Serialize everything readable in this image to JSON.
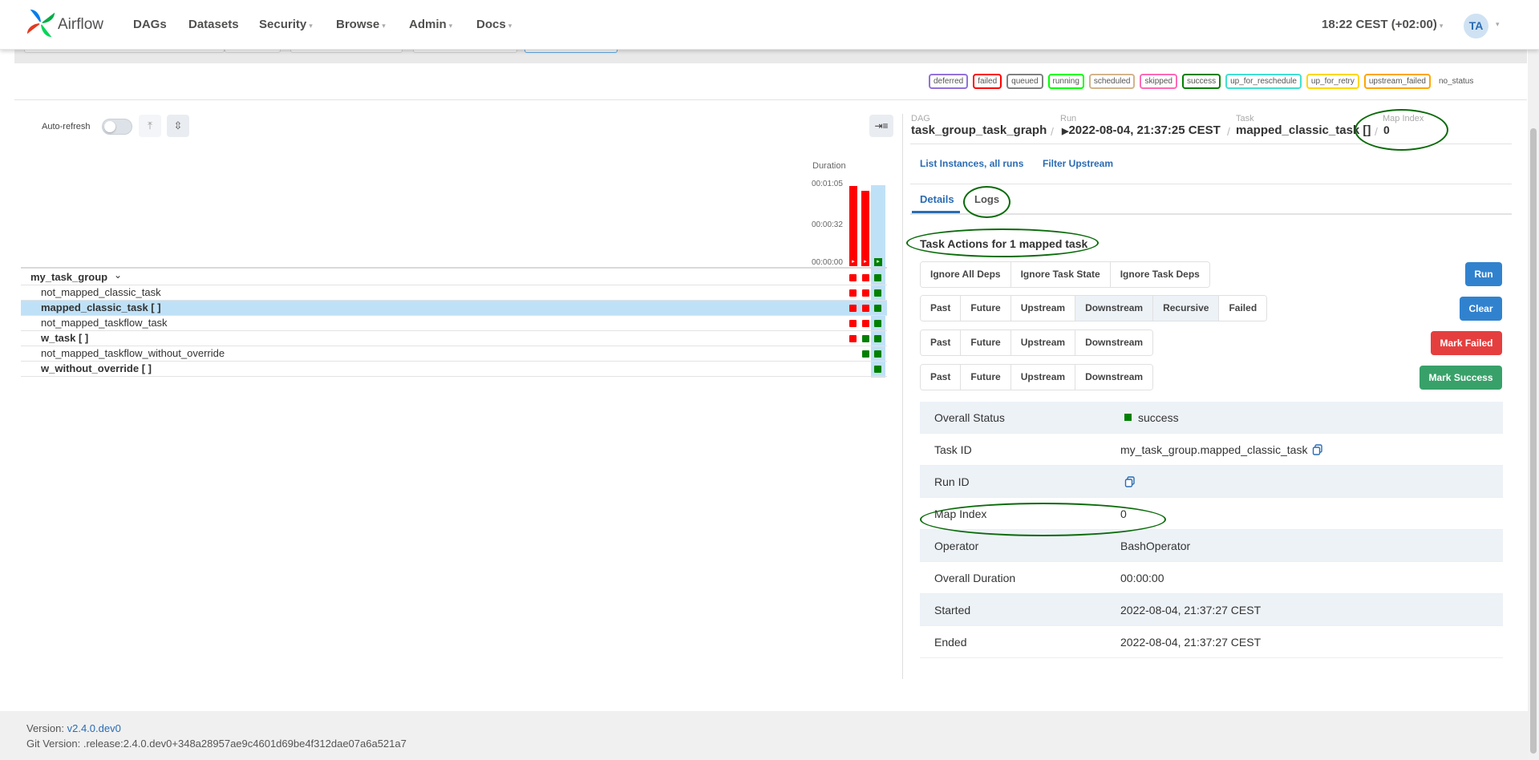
{
  "navbar": {
    "brand": "Airflow",
    "items": [
      {
        "label": "DAGs",
        "dropdown": false
      },
      {
        "label": "Datasets",
        "dropdown": false
      },
      {
        "label": "Security",
        "dropdown": true
      },
      {
        "label": "Browse",
        "dropdown": true
      },
      {
        "label": "Admin",
        "dropdown": true
      },
      {
        "label": "Docs",
        "dropdown": true
      }
    ],
    "clock": "18:22 CEST (+02:00)",
    "avatar": "TA"
  },
  "legend": {
    "states": [
      {
        "label": "deferred",
        "color": "#9370db"
      },
      {
        "label": "failed",
        "color": "#ff0000"
      },
      {
        "label": "queued",
        "color": "#808080"
      },
      {
        "label": "running",
        "color": "#00ff00"
      },
      {
        "label": "scheduled",
        "color": "#d2b48c"
      },
      {
        "label": "skipped",
        "color": "#ff69b4"
      },
      {
        "label": "success",
        "color": "#008000"
      },
      {
        "label": "up_for_reschedule",
        "color": "#40e0d0"
      },
      {
        "label": "up_for_retry",
        "color": "#ffd700"
      },
      {
        "label": "upstream_failed",
        "color": "#ffa500"
      }
    ],
    "no_status": "no_status"
  },
  "grid": {
    "auto_refresh_label": "Auto-refresh",
    "duration_label": "Duration",
    "duration_ticks": [
      "00:01:05",
      "00:00:32",
      "00:00:00"
    ],
    "runs": [
      {
        "duration_seconds": 65,
        "state": "failed"
      },
      {
        "duration_seconds": 61,
        "state": "failed"
      },
      {
        "duration_seconds": 0,
        "state": "success"
      }
    ],
    "tasks": [
      {
        "name": "my_task_group",
        "kind": "group",
        "selected": false,
        "states": [
          "failed",
          "failed",
          "success"
        ]
      },
      {
        "name": "not_mapped_classic_task",
        "kind": "task",
        "selected": false,
        "states": [
          "failed",
          "failed",
          "success"
        ]
      },
      {
        "name": "mapped_classic_task [ ]",
        "kind": "mapped",
        "selected": true,
        "states": [
          "failed",
          "failed",
          "success"
        ]
      },
      {
        "name": "not_mapped_taskflow_task",
        "kind": "task",
        "selected": false,
        "states": [
          "failed",
          "failed",
          "success"
        ]
      },
      {
        "name": "w_task [ ]",
        "kind": "mapped",
        "selected": false,
        "states": [
          "failed",
          "success",
          "success"
        ]
      },
      {
        "name": "not_mapped_taskflow_without_override",
        "kind": "task",
        "selected": false,
        "states": [
          null,
          "success",
          "success"
        ]
      },
      {
        "name": "w_without_override [ ]",
        "kind": "mapped",
        "selected": false,
        "states": [
          null,
          null,
          "success"
        ]
      }
    ]
  },
  "breadcrumb": {
    "dag_label": "DAG",
    "dag": "task_group_task_graph",
    "run_label": "Run",
    "run": "2022-08-04, 21:37:25 CEST",
    "task_label": "Task",
    "task": "mapped_classic_task []",
    "map_index_label": "Map Index",
    "map_index": "0"
  },
  "links": {
    "list_instances": "List Instances, all runs",
    "filter_upstream": "Filter Upstream"
  },
  "tabs": {
    "details": "Details",
    "logs": "Logs"
  },
  "actions": {
    "title": "Task Actions for 1 mapped task",
    "run_group": [
      "Ignore All Deps",
      "Ignore Task State",
      "Ignore Task Deps"
    ],
    "run_button": "Run",
    "clear_group": [
      {
        "label": "Past",
        "on": false
      },
      {
        "label": "Future",
        "on": false
      },
      {
        "label": "Upstream",
        "on": false
      },
      {
        "label": "Downstream",
        "on": true
      },
      {
        "label": "Recursive",
        "on": true
      },
      {
        "label": "Failed",
        "on": false
      }
    ],
    "clear_button": "Clear",
    "failed_group": [
      "Past",
      "Future",
      "Upstream",
      "Downstream"
    ],
    "mark_failed_button": "Mark Failed",
    "success_group": [
      "Past",
      "Future",
      "Upstream",
      "Downstream"
    ],
    "mark_success_button": "Mark Success",
    "colors": {
      "run": "#3182ce",
      "clear": "#3182ce",
      "mark_failed": "#e53e3e",
      "mark_success": "#38a169"
    }
  },
  "details": {
    "rows": [
      {
        "key": "Overall Status",
        "value": "success",
        "status_color": "#008000"
      },
      {
        "key": "Task ID",
        "value": "my_task_group.mapped_classic_task",
        "copy": true
      },
      {
        "key": "Run ID",
        "value": "",
        "copy": true
      },
      {
        "key": "Map Index",
        "value": "0"
      },
      {
        "key": "Operator",
        "value": "BashOperator"
      },
      {
        "key": "Overall Duration",
        "value": "00:00:00"
      },
      {
        "key": "Started",
        "value": "2022-08-04, 21:37:27 CEST"
      },
      {
        "key": "Ended",
        "value": "2022-08-04, 21:37:27 CEST"
      }
    ]
  },
  "footer": {
    "version_label": "Version:",
    "version": "v2.4.0.dev0",
    "git_label": "Git Version:",
    "git": ".release:2.4.0.dev0+348a28957ae9c4601d69be4f312dae07a6a521a7"
  }
}
